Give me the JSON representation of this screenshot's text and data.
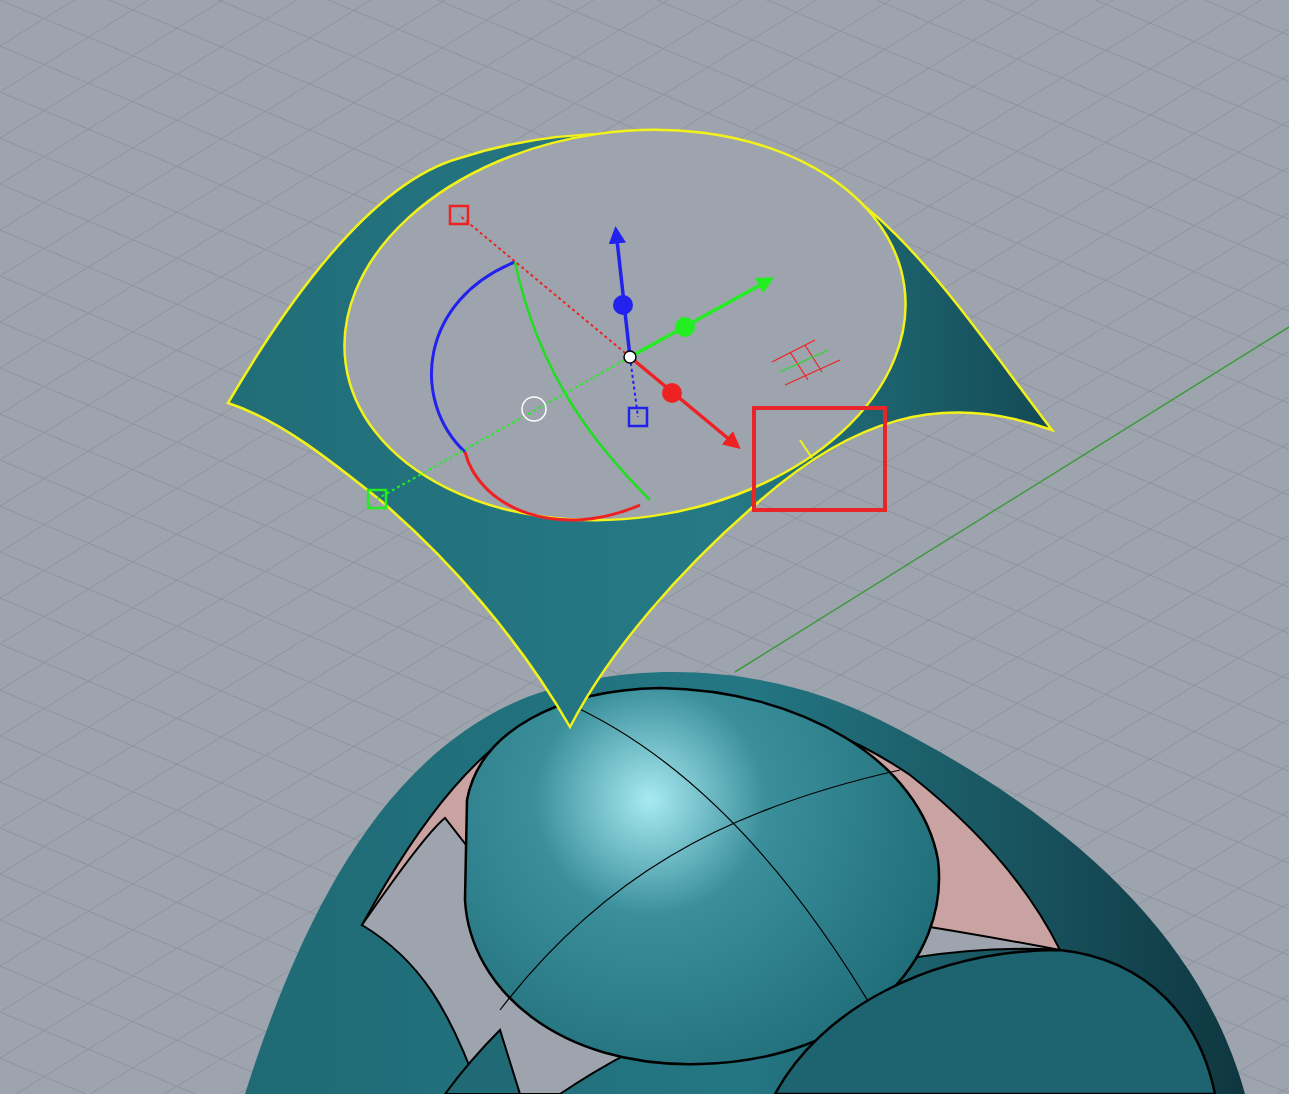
{
  "viewport": {
    "gumball_shown": true,
    "highlight_box_shown": true
  }
}
